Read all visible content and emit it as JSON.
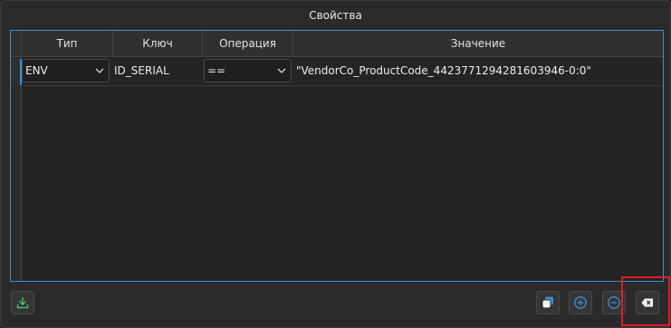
{
  "group_title": "Свойства",
  "table": {
    "columns": [
      "Тип",
      "Ключ",
      "Операция",
      "Значение"
    ],
    "rows": [
      {
        "type": "ENV",
        "key": "ID_SERIAL",
        "operation": "==",
        "value": "\"VendorCo_ProductCode_4423771294281603946-0:0\""
      }
    ]
  },
  "toolbar": {
    "left": [
      {
        "icon": "download-icon"
      }
    ],
    "right": [
      {
        "icon": "duplicate-icon"
      },
      {
        "icon": "add-icon"
      },
      {
        "icon": "remove-icon"
      },
      {
        "icon": "clear-icon",
        "highlighted": true
      }
    ]
  },
  "colors": {
    "accent": "#3d8fd1",
    "highlight": "#e01e1e",
    "download_green": "#4bbf6b"
  }
}
